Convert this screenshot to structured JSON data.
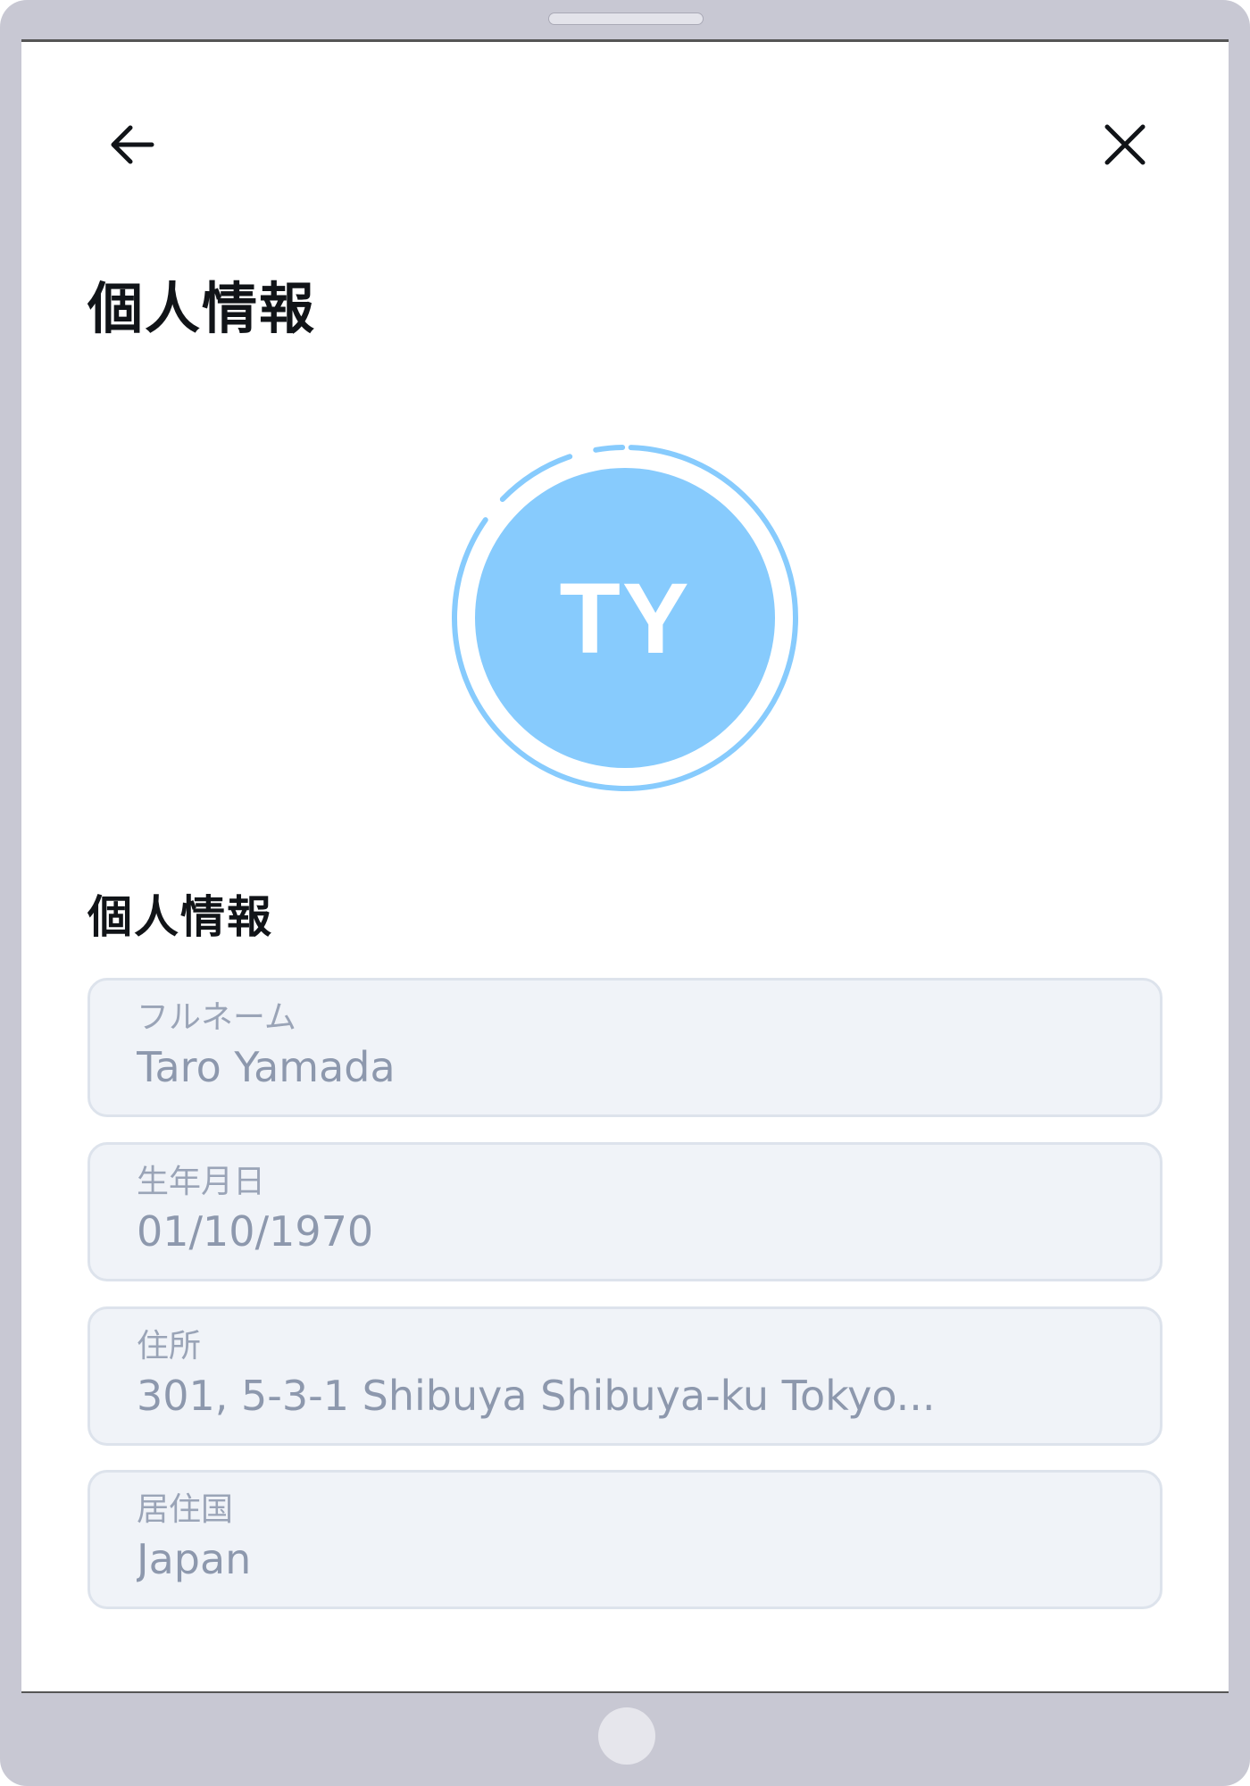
{
  "header": {
    "back_icon": "arrow-left-icon",
    "close_icon": "close-icon"
  },
  "page": {
    "title": "個人情報"
  },
  "avatar": {
    "initials": "TY",
    "color": "#87cbfd",
    "ring_color": "#87cbfd"
  },
  "section": {
    "title": "個人情報"
  },
  "fields": [
    {
      "label": "フルネーム",
      "value": "Taro Yamada"
    },
    {
      "label": "生年月日",
      "value": "01/10/1970"
    },
    {
      "label": "住所",
      "value": "301, 5-3-1 Shibuya Shibuya-ku Tokyo..."
    },
    {
      "label": "居住国",
      "value": "Japan"
    }
  ],
  "colors": {
    "title": "#111418",
    "field_background": "#f0f3f8",
    "field_border": "#dde3ec",
    "field_text": "#8d98ad"
  }
}
